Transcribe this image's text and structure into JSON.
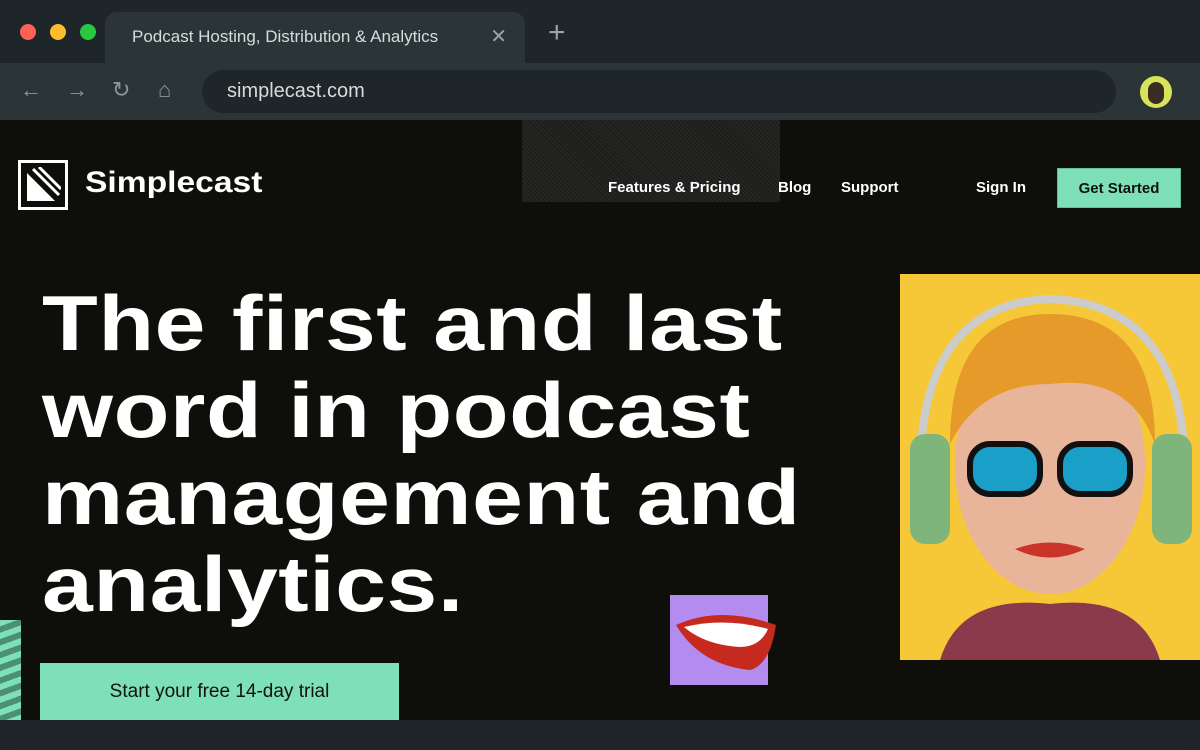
{
  "browser": {
    "tab_title": "Podcast Hosting, Distribution & Analytics",
    "url": "simplecast.com"
  },
  "site": {
    "brand": "Simplecast",
    "nav": [
      "Features & Pricing",
      "Blog",
      "Support"
    ],
    "sign_in": "Sign In",
    "get_started": "Get Started",
    "headline": [
      "The first and last",
      "word in podcast",
      "management and",
      "analytics."
    ],
    "trial_button": "Start your free 14-day trial"
  },
  "colors": {
    "accent": "#7ee0b7",
    "background": "#0e0e0a",
    "photo_bg": "#f6c838",
    "mouth_bg": "#b48cf0"
  }
}
